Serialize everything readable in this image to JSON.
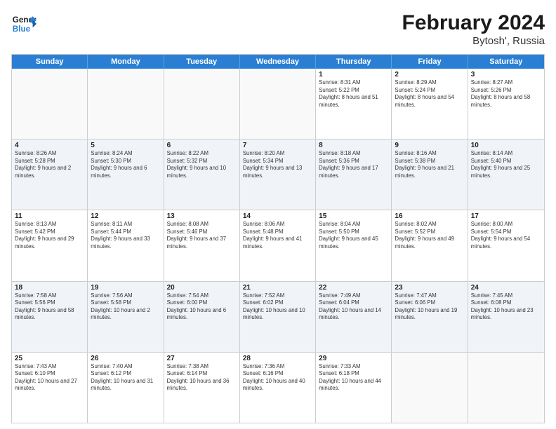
{
  "header": {
    "logo_line1": "General",
    "logo_line2": "Blue",
    "month": "February 2024",
    "location": "Bytosh', Russia"
  },
  "days_of_week": [
    "Sunday",
    "Monday",
    "Tuesday",
    "Wednesday",
    "Thursday",
    "Friday",
    "Saturday"
  ],
  "weeks": [
    [
      {
        "day": "",
        "sunrise": "",
        "sunset": "",
        "daylight": "",
        "empty": true
      },
      {
        "day": "",
        "sunrise": "",
        "sunset": "",
        "daylight": "",
        "empty": true
      },
      {
        "day": "",
        "sunrise": "",
        "sunset": "",
        "daylight": "",
        "empty": true
      },
      {
        "day": "",
        "sunrise": "",
        "sunset": "",
        "daylight": "",
        "empty": true
      },
      {
        "day": "1",
        "sunrise": "Sunrise: 8:31 AM",
        "sunset": "Sunset: 5:22 PM",
        "daylight": "Daylight: 8 hours and 51 minutes.",
        "empty": false
      },
      {
        "day": "2",
        "sunrise": "Sunrise: 8:29 AM",
        "sunset": "Sunset: 5:24 PM",
        "daylight": "Daylight: 8 hours and 54 minutes.",
        "empty": false
      },
      {
        "day": "3",
        "sunrise": "Sunrise: 8:27 AM",
        "sunset": "Sunset: 5:26 PM",
        "daylight": "Daylight: 8 hours and 58 minutes.",
        "empty": false
      }
    ],
    [
      {
        "day": "4",
        "sunrise": "Sunrise: 8:26 AM",
        "sunset": "Sunset: 5:28 PM",
        "daylight": "Daylight: 9 hours and 2 minutes.",
        "empty": false
      },
      {
        "day": "5",
        "sunrise": "Sunrise: 8:24 AM",
        "sunset": "Sunset: 5:30 PM",
        "daylight": "Daylight: 9 hours and 6 minutes.",
        "empty": false
      },
      {
        "day": "6",
        "sunrise": "Sunrise: 8:22 AM",
        "sunset": "Sunset: 5:32 PM",
        "daylight": "Daylight: 9 hours and 10 minutes.",
        "empty": false
      },
      {
        "day": "7",
        "sunrise": "Sunrise: 8:20 AM",
        "sunset": "Sunset: 5:34 PM",
        "daylight": "Daylight: 9 hours and 13 minutes.",
        "empty": false
      },
      {
        "day": "8",
        "sunrise": "Sunrise: 8:18 AM",
        "sunset": "Sunset: 5:36 PM",
        "daylight": "Daylight: 9 hours and 17 minutes.",
        "empty": false
      },
      {
        "day": "9",
        "sunrise": "Sunrise: 8:16 AM",
        "sunset": "Sunset: 5:38 PM",
        "daylight": "Daylight: 9 hours and 21 minutes.",
        "empty": false
      },
      {
        "day": "10",
        "sunrise": "Sunrise: 8:14 AM",
        "sunset": "Sunset: 5:40 PM",
        "daylight": "Daylight: 9 hours and 25 minutes.",
        "empty": false
      }
    ],
    [
      {
        "day": "11",
        "sunrise": "Sunrise: 8:13 AM",
        "sunset": "Sunset: 5:42 PM",
        "daylight": "Daylight: 9 hours and 29 minutes.",
        "empty": false
      },
      {
        "day": "12",
        "sunrise": "Sunrise: 8:11 AM",
        "sunset": "Sunset: 5:44 PM",
        "daylight": "Daylight: 9 hours and 33 minutes.",
        "empty": false
      },
      {
        "day": "13",
        "sunrise": "Sunrise: 8:08 AM",
        "sunset": "Sunset: 5:46 PM",
        "daylight": "Daylight: 9 hours and 37 minutes.",
        "empty": false
      },
      {
        "day": "14",
        "sunrise": "Sunrise: 8:06 AM",
        "sunset": "Sunset: 5:48 PM",
        "daylight": "Daylight: 9 hours and 41 minutes.",
        "empty": false
      },
      {
        "day": "15",
        "sunrise": "Sunrise: 8:04 AM",
        "sunset": "Sunset: 5:50 PM",
        "daylight": "Daylight: 9 hours and 45 minutes.",
        "empty": false
      },
      {
        "day": "16",
        "sunrise": "Sunrise: 8:02 AM",
        "sunset": "Sunset: 5:52 PM",
        "daylight": "Daylight: 9 hours and 49 minutes.",
        "empty": false
      },
      {
        "day": "17",
        "sunrise": "Sunrise: 8:00 AM",
        "sunset": "Sunset: 5:54 PM",
        "daylight": "Daylight: 9 hours and 54 minutes.",
        "empty": false
      }
    ],
    [
      {
        "day": "18",
        "sunrise": "Sunrise: 7:58 AM",
        "sunset": "Sunset: 5:56 PM",
        "daylight": "Daylight: 9 hours and 58 minutes.",
        "empty": false
      },
      {
        "day": "19",
        "sunrise": "Sunrise: 7:56 AM",
        "sunset": "Sunset: 5:58 PM",
        "daylight": "Daylight: 10 hours and 2 minutes.",
        "empty": false
      },
      {
        "day": "20",
        "sunrise": "Sunrise: 7:54 AM",
        "sunset": "Sunset: 6:00 PM",
        "daylight": "Daylight: 10 hours and 6 minutes.",
        "empty": false
      },
      {
        "day": "21",
        "sunrise": "Sunrise: 7:52 AM",
        "sunset": "Sunset: 6:02 PM",
        "daylight": "Daylight: 10 hours and 10 minutes.",
        "empty": false
      },
      {
        "day": "22",
        "sunrise": "Sunrise: 7:49 AM",
        "sunset": "Sunset: 6:04 PM",
        "daylight": "Daylight: 10 hours and 14 minutes.",
        "empty": false
      },
      {
        "day": "23",
        "sunrise": "Sunrise: 7:47 AM",
        "sunset": "Sunset: 6:06 PM",
        "daylight": "Daylight: 10 hours and 19 minutes.",
        "empty": false
      },
      {
        "day": "24",
        "sunrise": "Sunrise: 7:45 AM",
        "sunset": "Sunset: 6:08 PM",
        "daylight": "Daylight: 10 hours and 23 minutes.",
        "empty": false
      }
    ],
    [
      {
        "day": "25",
        "sunrise": "Sunrise: 7:43 AM",
        "sunset": "Sunset: 6:10 PM",
        "daylight": "Daylight: 10 hours and 27 minutes.",
        "empty": false
      },
      {
        "day": "26",
        "sunrise": "Sunrise: 7:40 AM",
        "sunset": "Sunset: 6:12 PM",
        "daylight": "Daylight: 10 hours and 31 minutes.",
        "empty": false
      },
      {
        "day": "27",
        "sunrise": "Sunrise: 7:38 AM",
        "sunset": "Sunset: 6:14 PM",
        "daylight": "Daylight: 10 hours and 36 minutes.",
        "empty": false
      },
      {
        "day": "28",
        "sunrise": "Sunrise: 7:36 AM",
        "sunset": "Sunset: 6:16 PM",
        "daylight": "Daylight: 10 hours and 40 minutes.",
        "empty": false
      },
      {
        "day": "29",
        "sunrise": "Sunrise: 7:33 AM",
        "sunset": "Sunset: 6:18 PM",
        "daylight": "Daylight: 10 hours and 44 minutes.",
        "empty": false
      },
      {
        "day": "",
        "sunrise": "",
        "sunset": "",
        "daylight": "",
        "empty": true
      },
      {
        "day": "",
        "sunrise": "",
        "sunset": "",
        "daylight": "",
        "empty": true
      }
    ]
  ]
}
